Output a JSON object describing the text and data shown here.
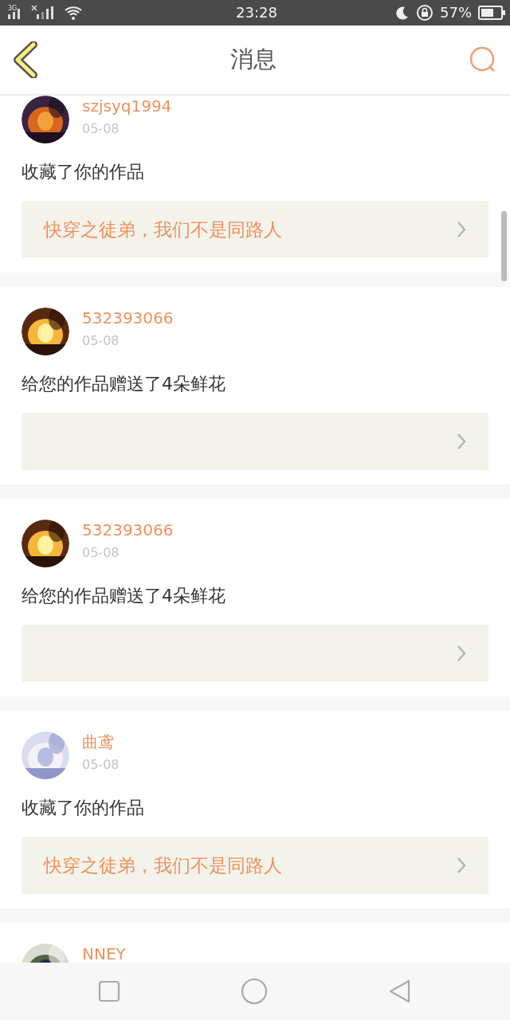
{
  "status_bar": {
    "network": "3G",
    "time": "23:28",
    "battery": "57%"
  },
  "header": {
    "title": "消息"
  },
  "messages": [
    {
      "user": "szjsyq1994",
      "date": "05-08",
      "action": "收藏了你的作品",
      "work_title": "快穿之徒弟，我们不是同路人"
    },
    {
      "user": "532393066",
      "date": "05-08",
      "action": "给您的作品赠送了4朵鲜花"
    },
    {
      "user": "532393066",
      "date": "05-08",
      "action": "给您的作品赠送了4朵鲜花"
    },
    {
      "user": "曲鸢",
      "date": "05-08",
      "action": "收藏了你的作品",
      "work_title": "快穿之徒弟，我们不是同路人"
    },
    {
      "user": "NNEY"
    }
  ]
}
